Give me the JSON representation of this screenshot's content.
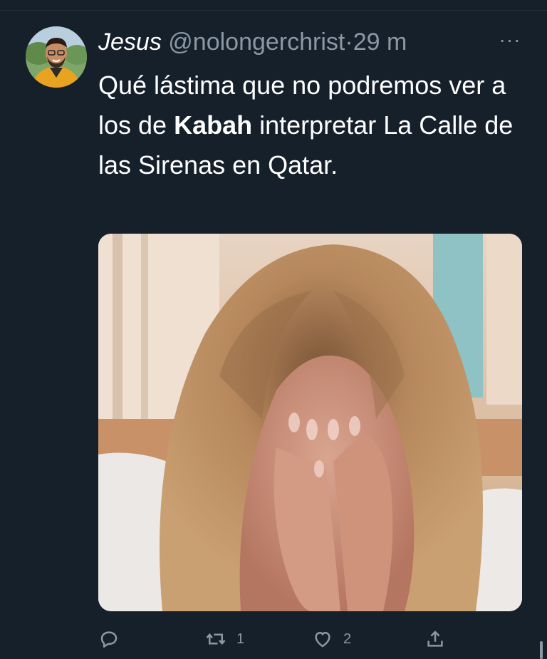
{
  "tweet": {
    "author_name": "Jesus",
    "author_handle": "@nolongerchrist",
    "separator": "·",
    "timestamp": "29 m",
    "more_label": "···",
    "text_part1": "Qué lástima que no podremos ver a los de ",
    "text_bold": "Kabah",
    "text_part2": " interpretar La Calle de las Sirenas en Qatar."
  },
  "actions": {
    "reply_count": "",
    "retweet_count": "1",
    "like_count": "2"
  },
  "icons": {
    "more": "more-icon",
    "reply": "reply-icon",
    "retweet": "retweet-icon",
    "like": "heart-icon",
    "share": "share-icon"
  },
  "colors": {
    "background": "#15202b",
    "text_primary": "#ffffff",
    "text_secondary": "#8b98a5",
    "avatar_jacket": "#e8a320"
  }
}
